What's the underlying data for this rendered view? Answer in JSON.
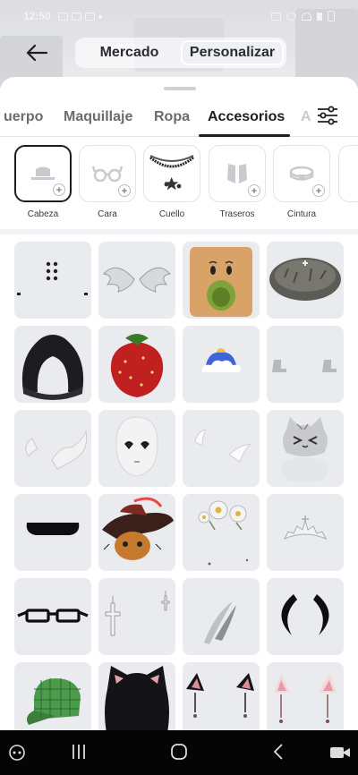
{
  "status": {
    "time": "12:50"
  },
  "header": {
    "segments": [
      {
        "label": "Mercado",
        "active": false
      },
      {
        "label": "Personalizar",
        "active": true
      }
    ]
  },
  "tabs": [
    {
      "label": "uerpo",
      "active": false
    },
    {
      "label": "Maquillaje",
      "active": false
    },
    {
      "label": "Ropa",
      "active": false
    },
    {
      "label": "Accesorios",
      "active": true
    }
  ],
  "subcategories": [
    {
      "label": "Cabeza",
      "active": true
    },
    {
      "label": "Cara",
      "active": false
    },
    {
      "label": "Cuello",
      "active": false
    },
    {
      "label": "Traseros",
      "active": false
    },
    {
      "label": "Cintura",
      "active": false
    }
  ],
  "items": [
    "face-dots-item",
    "wings-item",
    "green-mouth-head-item",
    "fur-hat-item",
    "black-hood-item",
    "strawberry-hat-item",
    "sun-cloud-item",
    "mini-boots-item",
    "white-horns-item",
    "white-mask-item",
    "small-horns-item",
    "gray-cat-item",
    "mustache-item",
    "puss-in-boots-item",
    "daisy-crown-item",
    "tiara-item",
    "glasses-item",
    "cross-earrings-item",
    "scythe-item",
    "black-horns-item",
    "green-cap-item",
    "cat-ear-hood-item",
    "cat-ears-black-item",
    "cat-ears-pink-item"
  ],
  "colors": {
    "accent": "#1d1e22",
    "tile_bg": "#eaebef",
    "navbar": "#050505"
  }
}
